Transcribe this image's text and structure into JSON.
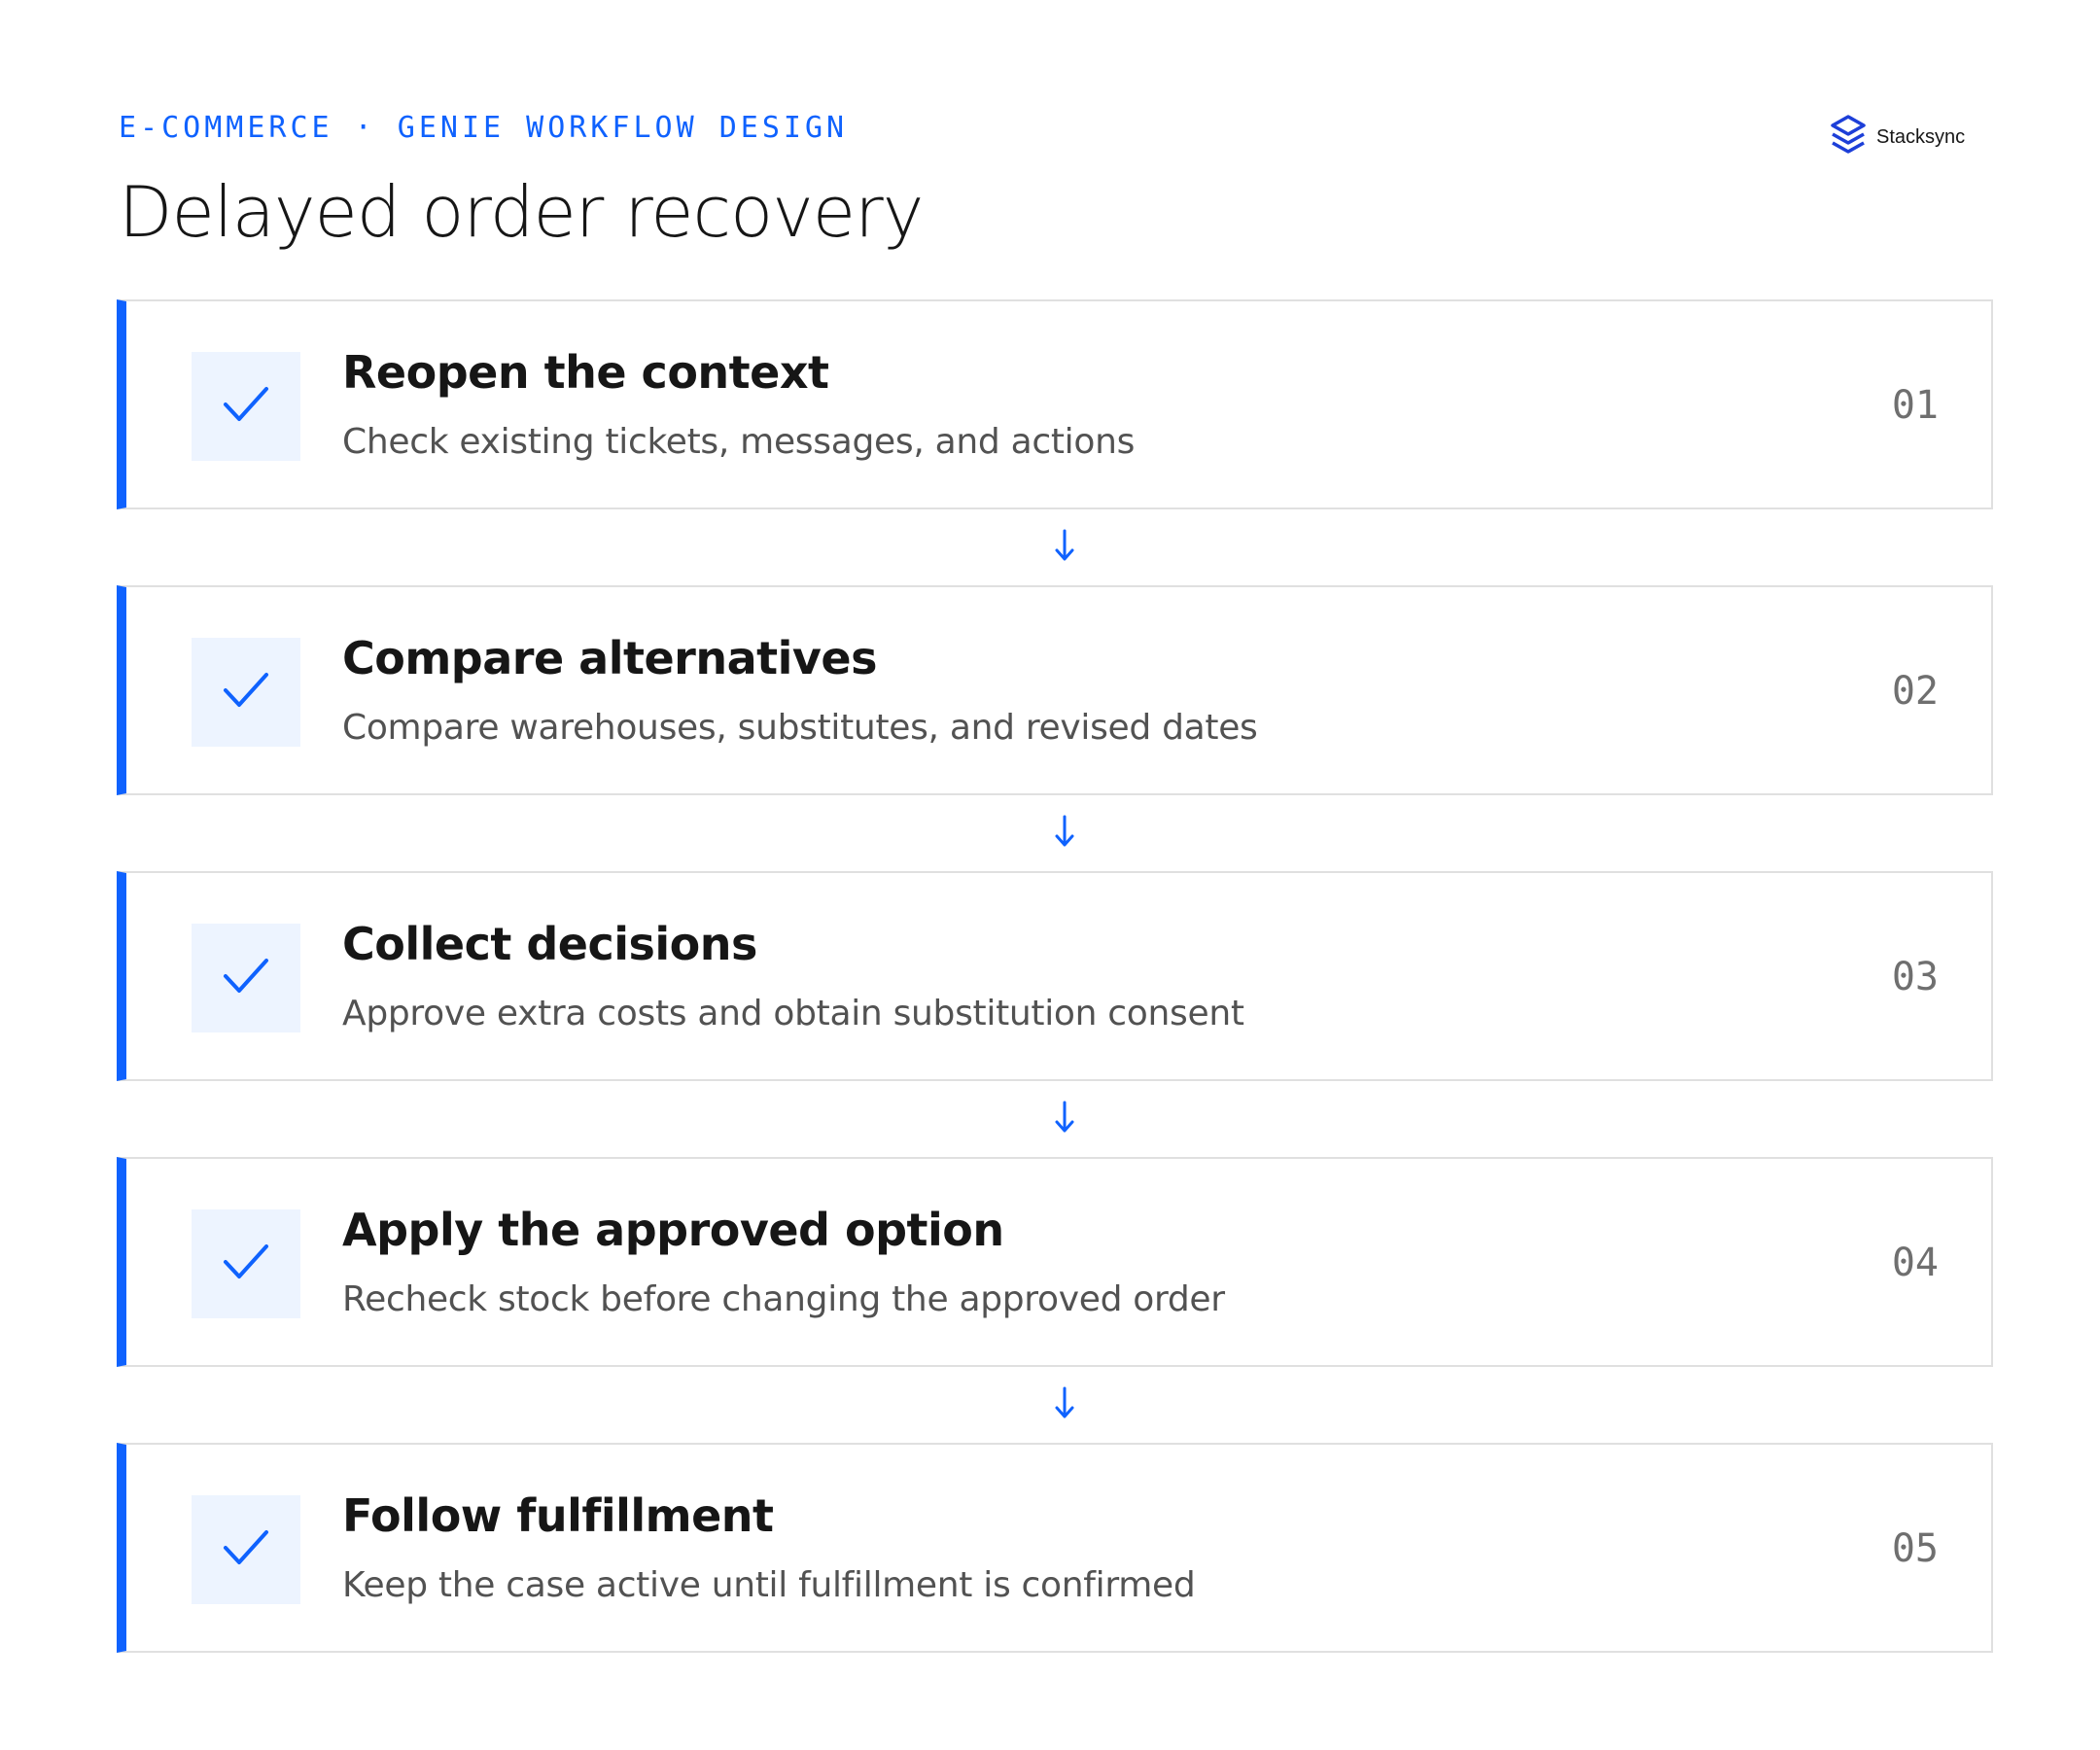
{
  "header": {
    "eyebrow": "E-COMMERCE · GENIE WORKFLOW DESIGN",
    "title": "Delayed order recovery"
  },
  "brand": {
    "name": "Stacksync",
    "icon": "stacksync-logo-icon"
  },
  "colors": {
    "accent": "#0f62fe",
    "check_bg": "#edf4ff",
    "border": "#e0e0e0",
    "title": "#161616",
    "description": "#525252",
    "number": "#6f6f6f"
  },
  "connector_icon": "arrow-down-icon",
  "steps": [
    {
      "number": "01",
      "title": "Reopen the context",
      "description": "Check existing tickets, messages, and actions",
      "status_icon": "check-icon"
    },
    {
      "number": "02",
      "title": "Compare alternatives",
      "description": "Compare warehouses, substitutes, and revised dates",
      "status_icon": "check-icon"
    },
    {
      "number": "03",
      "title": "Collect decisions",
      "description": "Approve extra costs and obtain substitution consent",
      "status_icon": "check-icon"
    },
    {
      "number": "04",
      "title": "Apply the approved option",
      "description": "Recheck stock before changing the approved order",
      "status_icon": "check-icon"
    },
    {
      "number": "05",
      "title": "Follow fulfillment",
      "description": "Keep the case active until fulfillment is confirmed",
      "status_icon": "check-icon"
    }
  ]
}
